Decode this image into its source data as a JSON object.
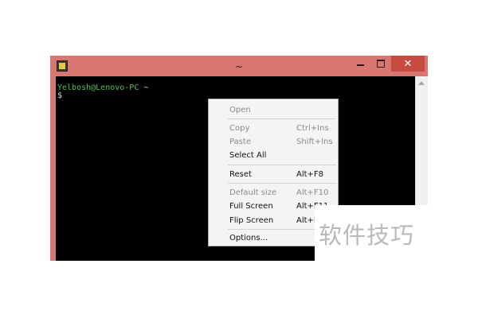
{
  "window": {
    "title": "~",
    "close_glyph": "✕"
  },
  "terminal": {
    "prompt_user": "Yelbosh@Lenovo-PC",
    "prompt_path": " ~",
    "cursor_line": "$"
  },
  "context_menu": {
    "items": [
      {
        "label": "Open",
        "shortcut": "",
        "enabled": false
      },
      {
        "label": "Copy",
        "shortcut": "Ctrl+Ins",
        "enabled": false
      },
      {
        "label": "Paste",
        "shortcut": "Shift+Ins",
        "enabled": false
      },
      {
        "label": "Select All",
        "shortcut": "",
        "enabled": true
      },
      {
        "label": "Reset",
        "shortcut": "Alt+F8",
        "enabled": true
      },
      {
        "label": "Default size",
        "shortcut": "Alt+F10",
        "enabled": false
      },
      {
        "label": "Full Screen",
        "shortcut": "Alt+F11",
        "enabled": true
      },
      {
        "label": "Flip Screen",
        "shortcut": "Alt+F12",
        "enabled": true
      },
      {
        "label": "Options...",
        "shortcut": "",
        "enabled": true
      }
    ]
  },
  "watermark": {
    "text": "软件技巧"
  },
  "colors": {
    "titlebar": "#d87671",
    "close_button": "#c84b3f",
    "terminal_bg": "#000000",
    "prompt_green": "#4fc24f"
  }
}
